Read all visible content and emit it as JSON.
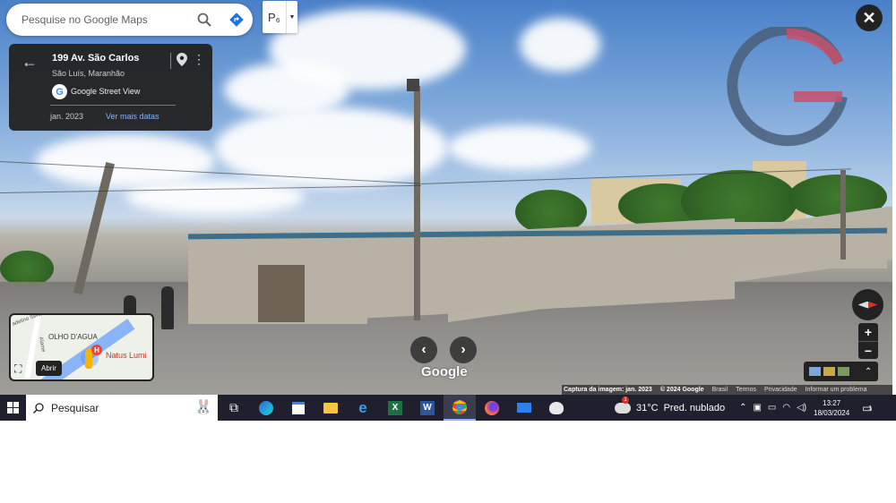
{
  "search": {
    "placeholder": "Pesquise no Google Maps"
  },
  "layers": {
    "label": "P₆"
  },
  "info_card": {
    "address": "199 Av. São Carlos",
    "city": "São Luís, Maranhão",
    "service": "Google Street View",
    "date": "jan. 2023",
    "see_more": "Ver mais datas"
  },
  "minimap": {
    "label_neighborhood": "OLHO D'AGUA",
    "label_place": "Natus Lumi",
    "label_street1": "adelino Silva",
    "label_street2": "Alame",
    "hpin": "H",
    "open_tooltip": "Abrir"
  },
  "scene": {
    "logo": "Google"
  },
  "attribution": {
    "capture": "Captura da imagem: jan. 2023",
    "copyright": "© 2024 Google",
    "country": "Brasil",
    "terms": "Termos",
    "privacy": "Privacidade",
    "report": "Informar um problema"
  },
  "zoom": {
    "plus": "+",
    "minus": "−"
  },
  "taskbar": {
    "search_label": "Pesquisar",
    "weather_temp": "31°C",
    "weather_desc": "Pred. nublado",
    "weather_badge": "1",
    "time": "13:27",
    "date": "18/03/2024",
    "notif_count": "1"
  },
  "colors": {
    "sky": "#6f9ed6",
    "card": "#222222",
    "link": "#8ab4f8",
    "taskbar": "#1f1f2e",
    "accent_red": "#d93025"
  },
  "icons": [
    "search-icon",
    "directions-icon",
    "close-icon",
    "back-arrow-icon",
    "pin-icon",
    "more-icon",
    "expand-icon",
    "compass-icon",
    "windows-icon",
    "task-view-icon",
    "edge-icon",
    "store-icon",
    "explorer-icon",
    "ie-icon",
    "excel-icon",
    "word-icon",
    "chrome-icon",
    "firefox-icon",
    "mail-icon",
    "paint-icon",
    "weather-icon",
    "notification-icon"
  ]
}
